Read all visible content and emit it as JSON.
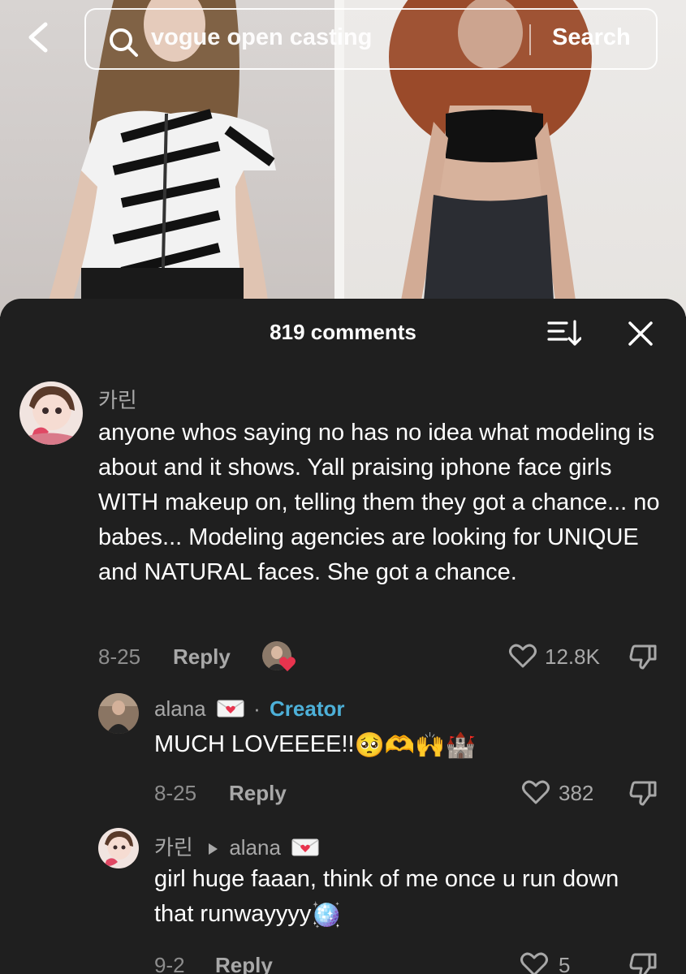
{
  "search": {
    "query": "vogue open casting",
    "button_label": "Search"
  },
  "sheet": {
    "title": "819 comments"
  },
  "comments": [
    {
      "username": "카린",
      "text": "anyone whos saying no has no idea what modeling is about and it shows. Yall praising iphone face girls WITH makeup on, telling them they got a chance... no babes... Modeling agencies are looking for UNIQUE and NATURAL faces. She got a chance.",
      "date": "8-25",
      "reply_label": "Reply",
      "likes": "12.8K"
    },
    {
      "username": "alana",
      "separator": "·",
      "badge": "Creator",
      "text": "MUCH LOVEEEE!!",
      "emojis": "🥺🫶🙌🏰",
      "date": "8-25",
      "reply_label": "Reply",
      "likes": "382"
    },
    {
      "username": "카린",
      "reply_to": "alana",
      "text": "girl huge faaan, think of me once u run down that runwayyyy",
      "emoji": "🪩",
      "date": "9-2",
      "reply_label": "Reply",
      "likes": "5"
    }
  ],
  "colors": {
    "sheet_bg": "#1f1f1f",
    "creator_badge": "#4db0d8",
    "heart_reaction": "#e8344e"
  }
}
